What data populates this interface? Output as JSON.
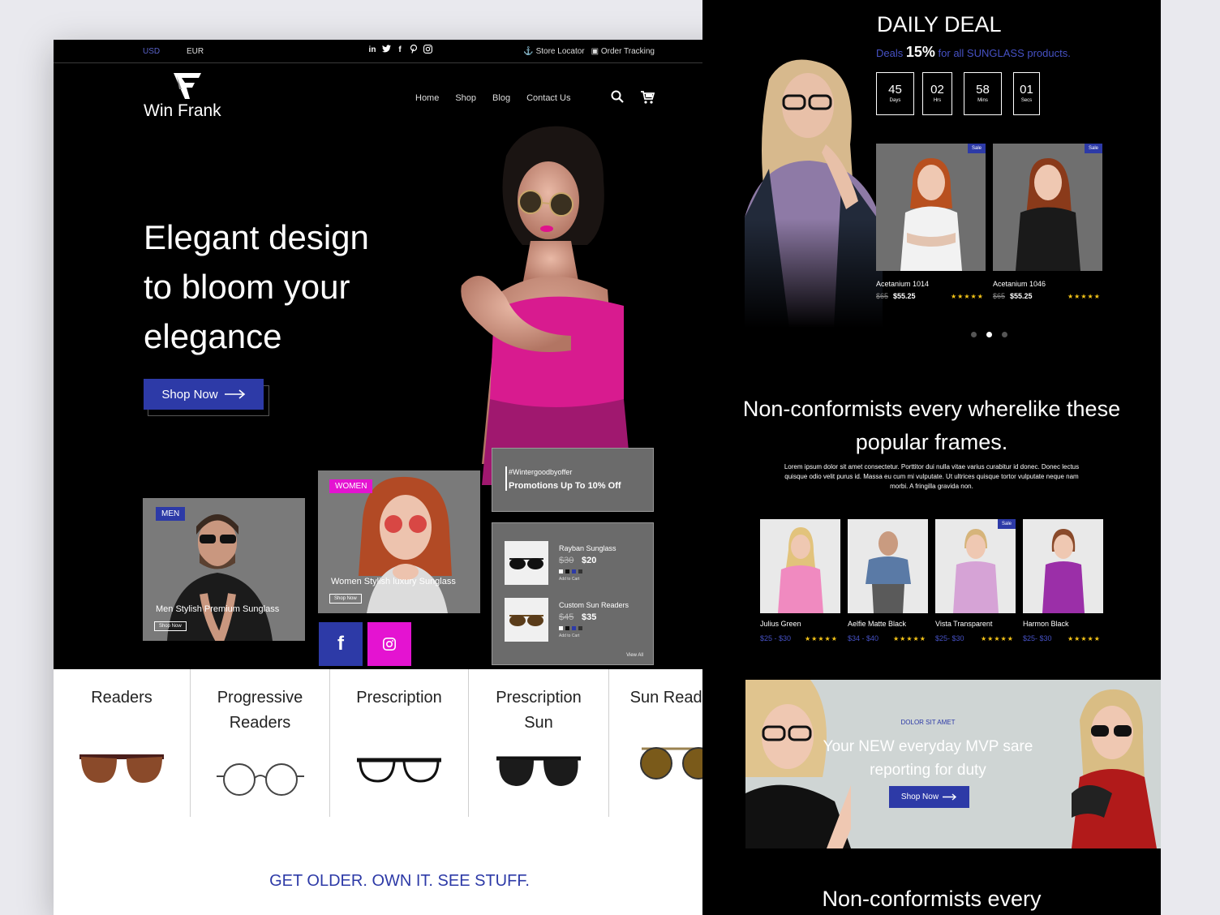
{
  "topbar": {
    "usd": "USD",
    "eur": "EUR",
    "store_locator": "Store Locator",
    "order_tracking": "Order Tracking"
  },
  "socials": [
    "in",
    "twitter",
    "f",
    "pinterest",
    "instagram"
  ],
  "brand": {
    "name": "Win Frank"
  },
  "nav": [
    "Home",
    "Shop",
    "Blog",
    "Contact Us"
  ],
  "hero": {
    "title": "Elegant design to bloom your elegance",
    "cta": "Shop Now"
  },
  "cards": {
    "men": {
      "tag": "MEN",
      "caption": "Men Stylish Premium Sunglass",
      "btn": "Shop Now"
    },
    "women": {
      "tag": "WOMEN",
      "caption": "Women Stylish luxury Sunglass",
      "btn": "Shop Now"
    }
  },
  "promo": {
    "hashtag": "#Wintergoodbyoffer",
    "text": "Promotions Up To 10% Off"
  },
  "mini_products": [
    {
      "name": "Rayban  Sunglass",
      "old": "$30",
      "new": "$20",
      "add": "Add to Cart"
    },
    {
      "name": "Custom Sun Readers",
      "old": "$45",
      "new": "$35",
      "add": "Add to Cart"
    }
  ],
  "view_all": "View All",
  "categories": [
    "Readers",
    "Progressive Readers",
    "Prescription",
    "Prescription Sun",
    "Sun Readers"
  ],
  "tagline": "GET OLDER. OWN IT. SEE STUFF.",
  "daily_deal": {
    "title": "DAILY DEAL",
    "sub_prefix": "Deals",
    "percent": "15%",
    "sub_suffix": "for all SUNGLASS products.",
    "timer": [
      {
        "n": "45",
        "u": "Days"
      },
      {
        "n": "02",
        "u": "Hrs"
      },
      {
        "n": "58",
        "u": "Mins"
      },
      {
        "n": "01",
        "u": "Secs"
      }
    ],
    "products": [
      {
        "name": "Acetanium 1014",
        "old": "$65",
        "new": "$55.25",
        "sale": "Sale"
      },
      {
        "name": "Acetanium 1046",
        "old": "$65",
        "new": "$55.25",
        "sale": "Sale"
      }
    ]
  },
  "popular": {
    "title": "Non-conformists every wherelike these popular frames.",
    "desc": "Lorem ipsum dolor sit amet consectetur. Porttitor dui nulla vitae varius curabitur id donec. Donec lectus quisque odio velit purus id. Massa eu cum mi vulputate. Ut ultrices quisque tortor vulputate neque nam morbi. A fringilla gravida non.",
    "items": [
      {
        "name": "Julius Green",
        "price": "$25 - $30"
      },
      {
        "name": "Aelfie Matte Black",
        "price": "$34 - $40"
      },
      {
        "name": "Vista Transparent",
        "price": "$25- $30",
        "sale": "Sale"
      },
      {
        "name": "Harmon Black",
        "price": "$25- $30"
      }
    ]
  },
  "banner": {
    "kicker": "DOLOR SIT AMET",
    "head": "Your NEW everyday MVP sare reporting for duty",
    "btn": "Shop Now"
  },
  "bottom_title": "Non-conformists every",
  "colors": {
    "accent": "#2d3aa7",
    "pink": "#e413d1",
    "star": "#f5c518"
  }
}
